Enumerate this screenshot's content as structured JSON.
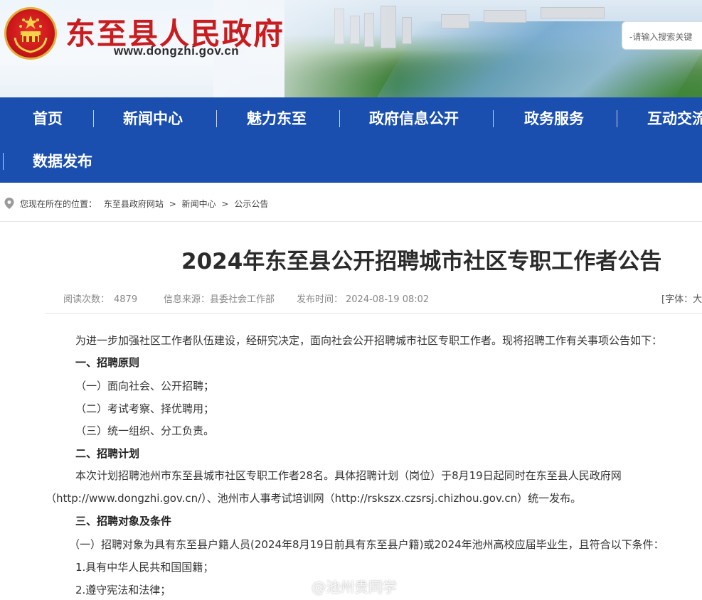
{
  "header": {
    "site_title": "东至县人民政府",
    "site_url": "www.dongzhi.gov.cn",
    "search_placeholder": "-请输入搜索关键"
  },
  "nav": {
    "items": [
      {
        "label": "首页"
      },
      {
        "label": "新闻中心"
      },
      {
        "label": "魅力东至"
      },
      {
        "label": "政府信息公开"
      },
      {
        "label": "政务服务"
      },
      {
        "label": "互动交流"
      },
      {
        "label": "数据发布"
      }
    ]
  },
  "breadcrumb": {
    "prefix": "您现在所在的位置：",
    "items": [
      "东至县政府网站",
      "新闻中心",
      "公示公告"
    ],
    "separator": ">"
  },
  "article": {
    "title": "2024年东至县公开招聘城市社区专职工作者公告",
    "views_label": "阅读次数：",
    "views": "4879",
    "source_label": "信息来源：",
    "source": "县委社会工作部",
    "time_label": "发布时间：",
    "time": "2024-08-19 08:02",
    "font_size_label": "[字体：大",
    "paragraphs": [
      "为进一步加强社区工作者队伍建设，经研究决定，面向社会公开招聘城市社区专职工作者。现将招聘工作有关事项公告如下：",
      "一、招聘原则",
      "（一）面向社会、公开招聘；",
      "（二）考试考察、择优聘用；",
      "（三）统一组织、分工负责。",
      "二、招聘计划",
      "本次计划招聘池州市东至县城市社区专职工作者28名。具体招聘计划（岗位）于8月19日起同时在东至县人民政府网",
      "（http://www.dongzhi.gov.cn/）、池州市人事考试培训网（http://rskszx.czsrsj.chizhou.gov.cn）统一发布。",
      "三、招聘对象及条件",
      "（一）招聘对象为具有东至县户籍人员(2024年8月19日前具有东至县户籍)或2024年池州高校应届毕业生，且符合以下条件：",
      "1.具有中华人民共和国国籍；",
      "2.遵守宪法和法律；"
    ]
  },
  "watermark": "@池州贵同学",
  "colors": {
    "nav_bg": "#1a4fb0",
    "title_red": "#c81c1f"
  }
}
